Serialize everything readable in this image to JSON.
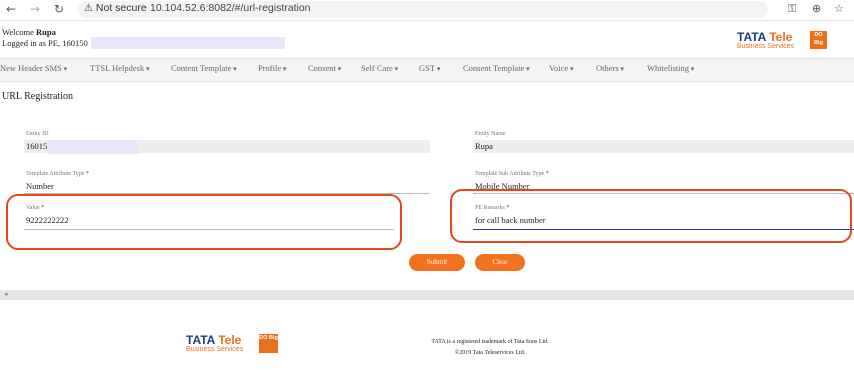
{
  "browser": {
    "back_icon": "arrow-left",
    "forward_icon": "arrow-right",
    "reload_icon": "reload",
    "security_label": "Not secure",
    "url": "10.104.52.6:8082/#/url-registration"
  },
  "header": {
    "welcome_prefix": "Welcome",
    "welcome_name": "Rupa",
    "logged_in": "Logged in as PE, 160150",
    "logo": {
      "brand": "TATA",
      "brand2": "Tele",
      "sub": "Business Services",
      "badge": "DO Big"
    }
  },
  "menu": [
    "New Header SMS",
    "TTSL Helpdesk",
    "Content Template",
    "Profile",
    "Consent",
    "Self Care",
    "GST",
    "Consent Template",
    "Voice",
    "Others",
    "Whitelisting"
  ],
  "page_title": "URL Registration",
  "form": {
    "entity_id": {
      "label": "Entity ID",
      "value": "16015"
    },
    "entity_name": {
      "label": "Entity Name",
      "value": "Rupa"
    },
    "template_attr_type": {
      "label": "Template Attribute Type",
      "required": "*",
      "value": "Number"
    },
    "template_sub_attr_type": {
      "label": "Template Sub Attribute Type",
      "required": "*",
      "value": "Mobile Number"
    },
    "value": {
      "label": "Value",
      "required": "*",
      "value": "9222222222"
    },
    "pe_remarks": {
      "label": "PE Remarks",
      "required": "*",
      "value": "for call back number"
    },
    "submit_label": "Submit",
    "clear_label": "Clear"
  },
  "footer": {
    "trademark": "TATA is a registered trademark of Tata Sons Ltd.",
    "copyright": "©2019 Tata Teleservices Ltd."
  },
  "colors": {
    "accent": "#f2711f",
    "highlight": "#e0491c",
    "brand_blue": "#1b3a8a"
  }
}
